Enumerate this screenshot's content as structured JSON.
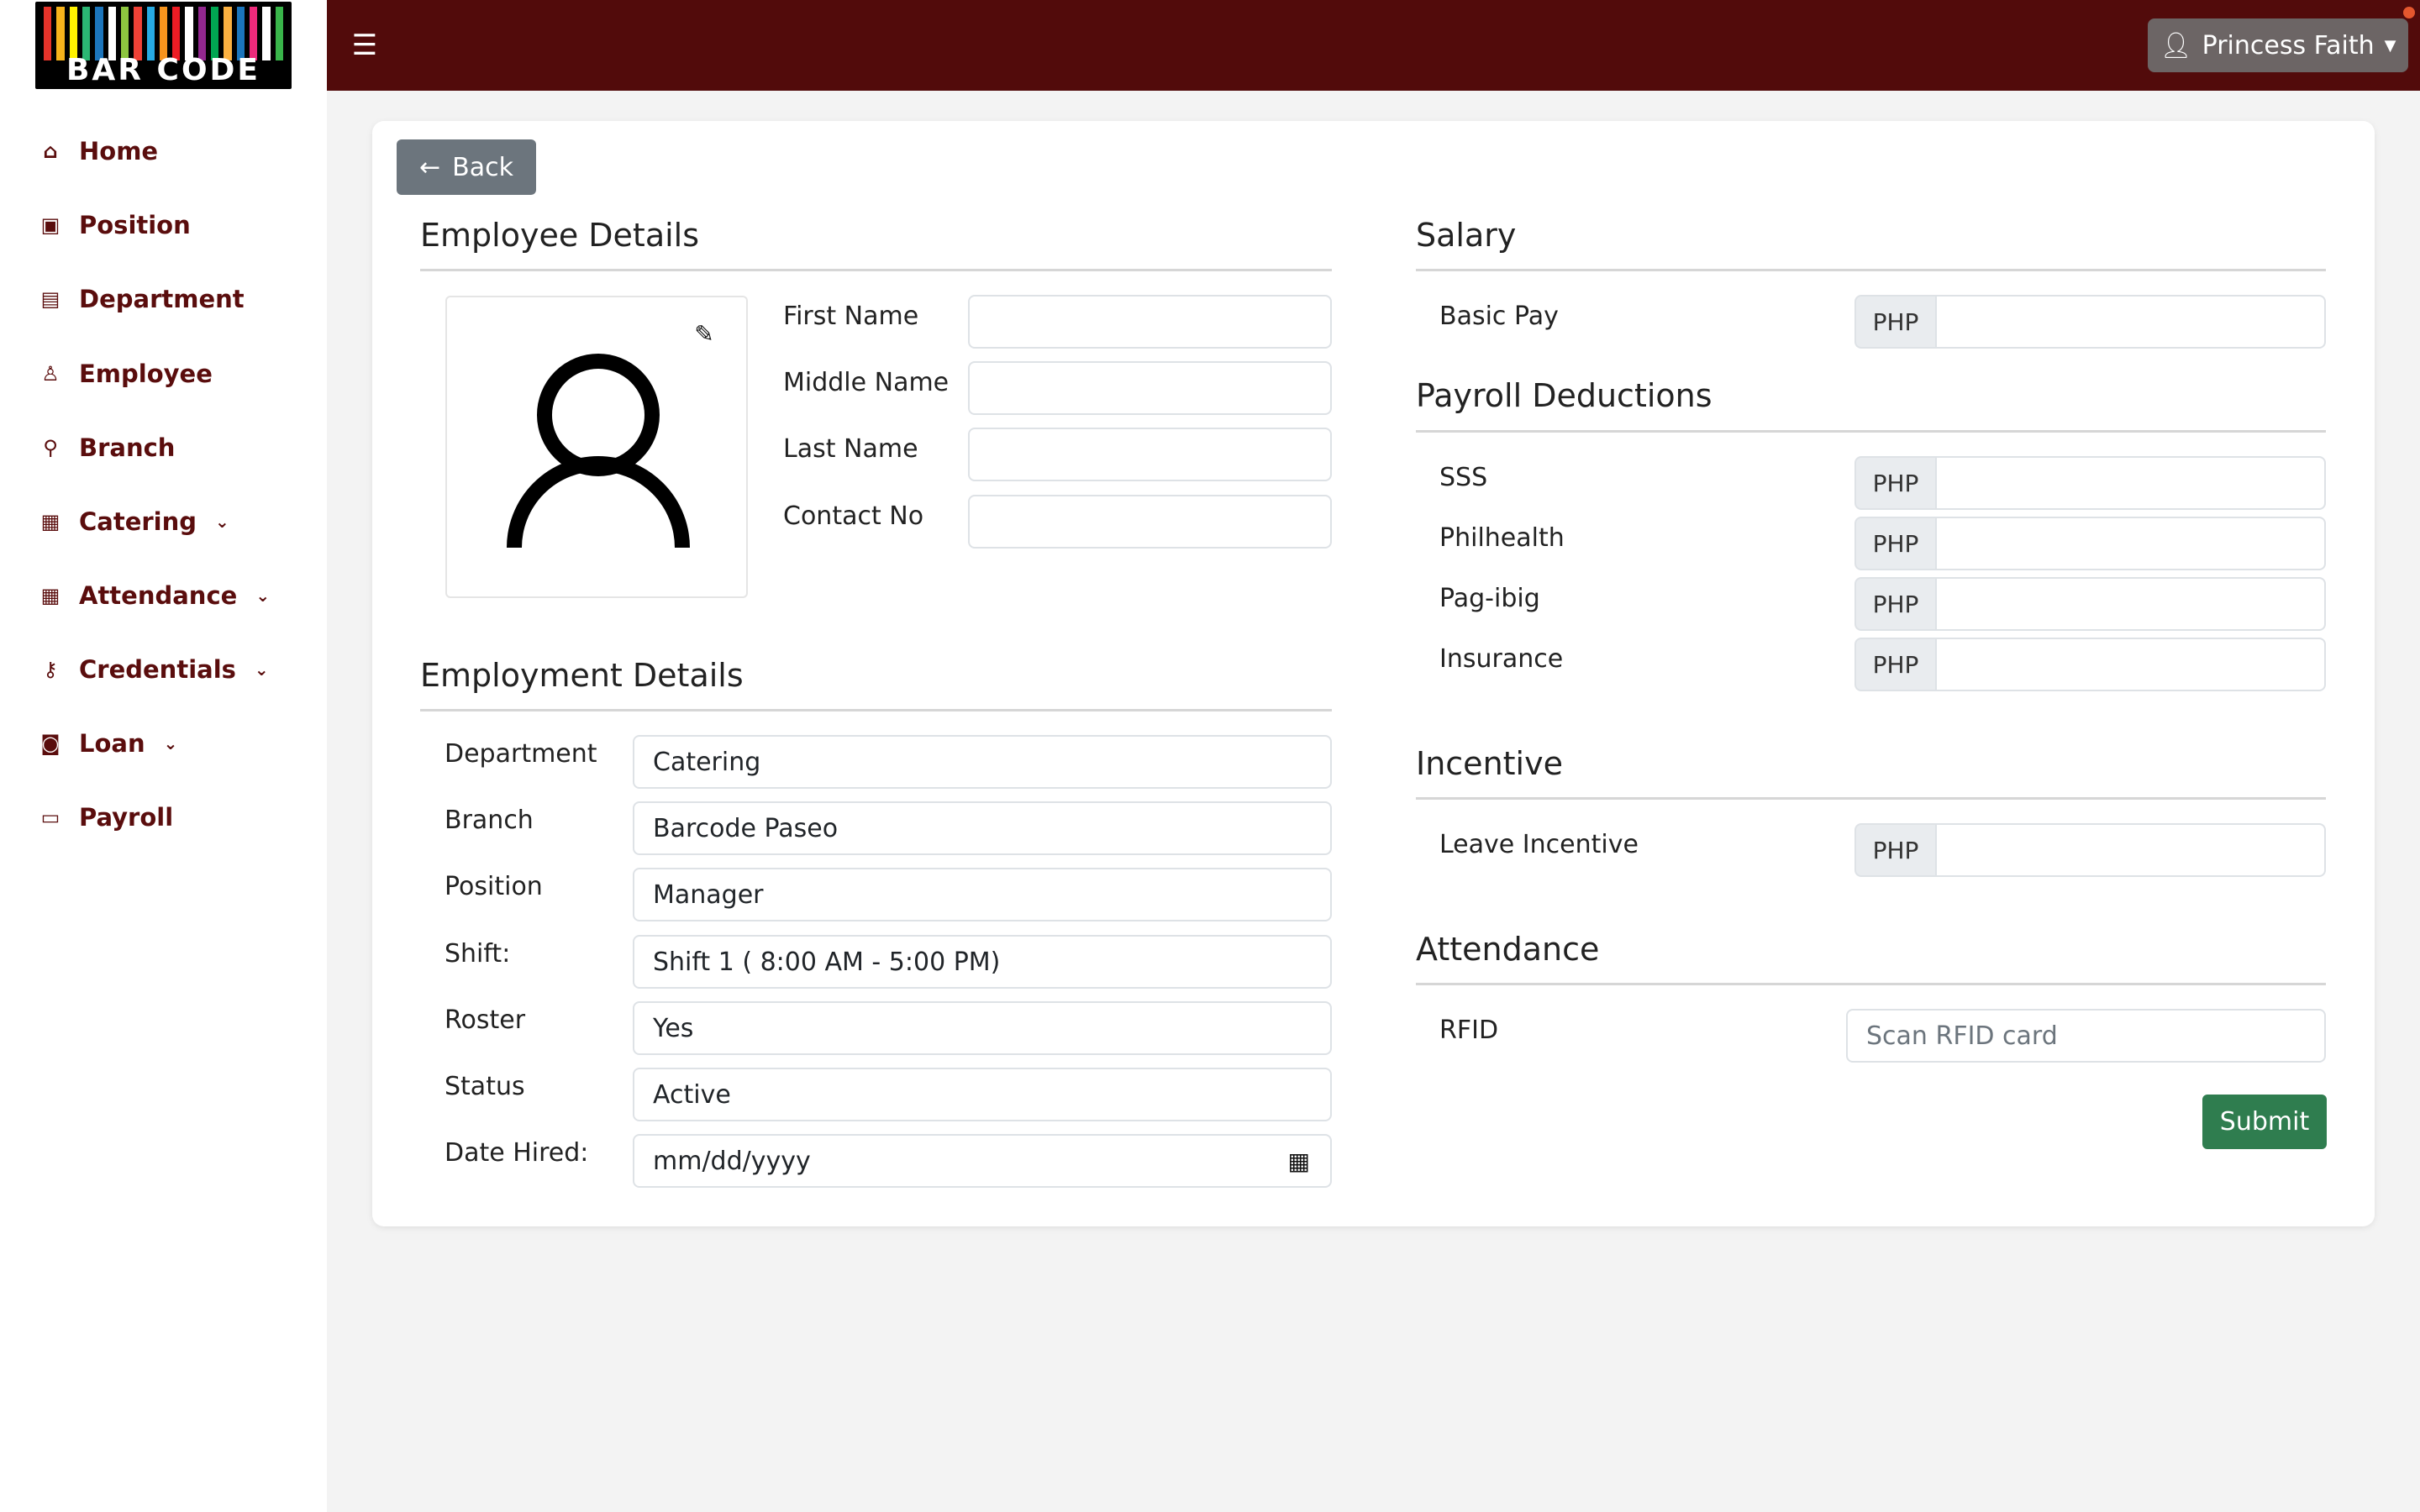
{
  "header": {
    "logo_text": "BAR CODE",
    "logo_stripe_colors": [
      "#e6332a",
      "#f6b31b",
      "#fff200",
      "#2bb673",
      "#1c75bc",
      "#ffffff",
      "#8dc63f",
      "#ef4136",
      "#27aae1",
      "#f7941d",
      "#ed1c24",
      "#ffffff",
      "#92278f",
      "#00a651",
      "#fbb040",
      "#1b75bc",
      "#ee2a7b",
      "#ffffff",
      "#39b54a"
    ],
    "menu_icon": "list-icon",
    "user_name": "Princess Faith",
    "colors": {
      "topbar": "#520b0b",
      "accent_text": "#5a0d0d",
      "submit": "#2f7d4f",
      "back": "#6c757d"
    }
  },
  "sidebar": {
    "items": [
      {
        "label": "Home",
        "icon": "home-icon",
        "has_chevron": false
      },
      {
        "label": "Position",
        "icon": "badge-icon",
        "has_chevron": false
      },
      {
        "label": "Department",
        "icon": "building-icon",
        "has_chevron": false
      },
      {
        "label": "Employee",
        "icon": "person-icon",
        "has_chevron": false
      },
      {
        "label": "Branch",
        "icon": "branch-icon",
        "has_chevron": false
      },
      {
        "label": "Catering",
        "icon": "journal-icon",
        "has_chevron": true
      },
      {
        "label": "Attendance",
        "icon": "calendar-icon",
        "has_chevron": true
      },
      {
        "label": "Credentials",
        "icon": "key-icon",
        "has_chevron": true
      },
      {
        "label": "Loan",
        "icon": "cash-icon",
        "has_chevron": true
      },
      {
        "label": "Payroll",
        "icon": "credit-card-icon",
        "has_chevron": false
      }
    ]
  },
  "main": {
    "back_label": "Back",
    "employee_details": {
      "title": "Employee Details",
      "fields": [
        {
          "label": "First Name",
          "value": ""
        },
        {
          "label": "Middle Name",
          "value": ""
        },
        {
          "label": "Last Name",
          "value": ""
        },
        {
          "label": "Contact No",
          "value": ""
        }
      ]
    },
    "employment_details": {
      "title": "Employment Details",
      "fields": [
        {
          "label": "Department",
          "value": "Catering"
        },
        {
          "label": "Branch",
          "value": "Barcode Paseo"
        },
        {
          "label": "Position",
          "value": "Manager"
        },
        {
          "label": "Shift:",
          "value": "Shift 1 ( 8:00 AM - 5:00 PM)"
        },
        {
          "label": "Roster",
          "value": "Yes"
        },
        {
          "label": "Status",
          "value": "Active"
        },
        {
          "label": "Date Hired:",
          "value": "mm/dd/yyyy"
        }
      ]
    },
    "salary": {
      "title": "Salary",
      "fields": [
        {
          "label": "Basic Pay",
          "prefix": "PHP",
          "value": ""
        }
      ]
    },
    "payroll_deductions": {
      "title": "Payroll Deductions",
      "fields": [
        {
          "label": "SSS",
          "prefix": "PHP",
          "value": ""
        },
        {
          "label": "Philhealth",
          "prefix": "PHP",
          "value": ""
        },
        {
          "label": "Pag-ibig",
          "prefix": "PHP",
          "value": ""
        },
        {
          "label": "Insurance",
          "prefix": "PHP",
          "value": ""
        }
      ]
    },
    "incentive": {
      "title": "Incentive",
      "fields": [
        {
          "label": "Leave Incentive",
          "prefix": "PHP",
          "value": ""
        }
      ]
    },
    "attendance": {
      "title": "Attendance",
      "rfid_label": "RFID",
      "rfid_placeholder": "Scan RFID card"
    },
    "submit_label": "Submit"
  }
}
